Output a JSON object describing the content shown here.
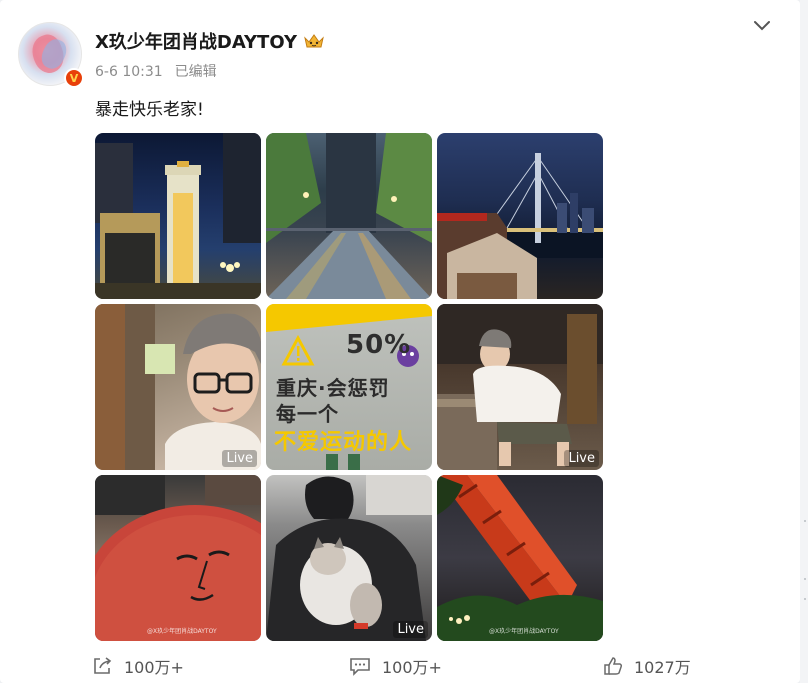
{
  "post": {
    "author": {
      "name": "X玖少年团肖战DAYTOY",
      "verified_badge": "V",
      "avatar_icon": "avatar-image",
      "crown_icon": "crown-icon"
    },
    "meta": {
      "time": "6-6 10:31",
      "edited": "已编辑"
    },
    "text": "暴走快乐老家!",
    "images": [
      {
        "label": "",
        "desc_icon": "night-tower-photo"
      },
      {
        "label": "",
        "desc_icon": "rainy-street-photo"
      },
      {
        "label": "",
        "desc_icon": "bridge-night-photo"
      },
      {
        "label": "Live",
        "desc_icon": "selfie-glasses-photo"
      },
      {
        "label": "",
        "desc_icon": "sign-photo"
      },
      {
        "label": "Live",
        "desc_icon": "seated-man-photo"
      },
      {
        "label": "",
        "desc_icon": "red-face-sculpture-photo"
      },
      {
        "label": "Live",
        "desc_icon": "cat-hug-photo"
      },
      {
        "label": "",
        "desc_icon": "red-bridge-photo"
      }
    ],
    "sign": {
      "percent": "50%",
      "line1": "重庆·会惩罚",
      "line2": "每一个",
      "line3": "不爱运动的人"
    },
    "watermark": "@X玖少年团肖战DAYTOY"
  },
  "actions": {
    "share": {
      "label": "100万+",
      "icon": "share-icon"
    },
    "comment": {
      "label": "100万+",
      "icon": "comment-icon"
    },
    "like": {
      "label": "1027万",
      "icon": "like-icon"
    }
  },
  "colors": {
    "badge": "#e8400a",
    "sign_yellow": "#f5c800",
    "meta_gray": "#8c8c8c"
  }
}
